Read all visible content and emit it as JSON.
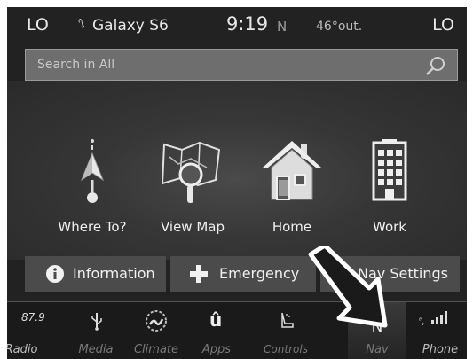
{
  "status": {
    "lo_left": "LO",
    "phone_name": "Galaxy S6",
    "clock": "9:19",
    "compass": "N",
    "temp": "46°out.",
    "lo_right": "LO"
  },
  "search": {
    "placeholder": "Search in All"
  },
  "tiles": [
    {
      "label": "Where To?",
      "icon": "where-to-pin-icon"
    },
    {
      "label": "View Map",
      "icon": "map-magnifier-icon"
    },
    {
      "label": "Home",
      "icon": "house-icon"
    },
    {
      "label": "Work",
      "icon": "office-building-icon"
    }
  ],
  "actions": {
    "information": "Information",
    "emergency": "Emergency",
    "nav_settings": "Nav Settings"
  },
  "navbar": {
    "radio_freq": "87.9",
    "radio": "Radio",
    "media": "Media",
    "climate": "Climate",
    "apps": "Apps",
    "controls": "Controls",
    "nav": "Nav",
    "nav_glyph": "N",
    "phone": "Phone"
  }
}
